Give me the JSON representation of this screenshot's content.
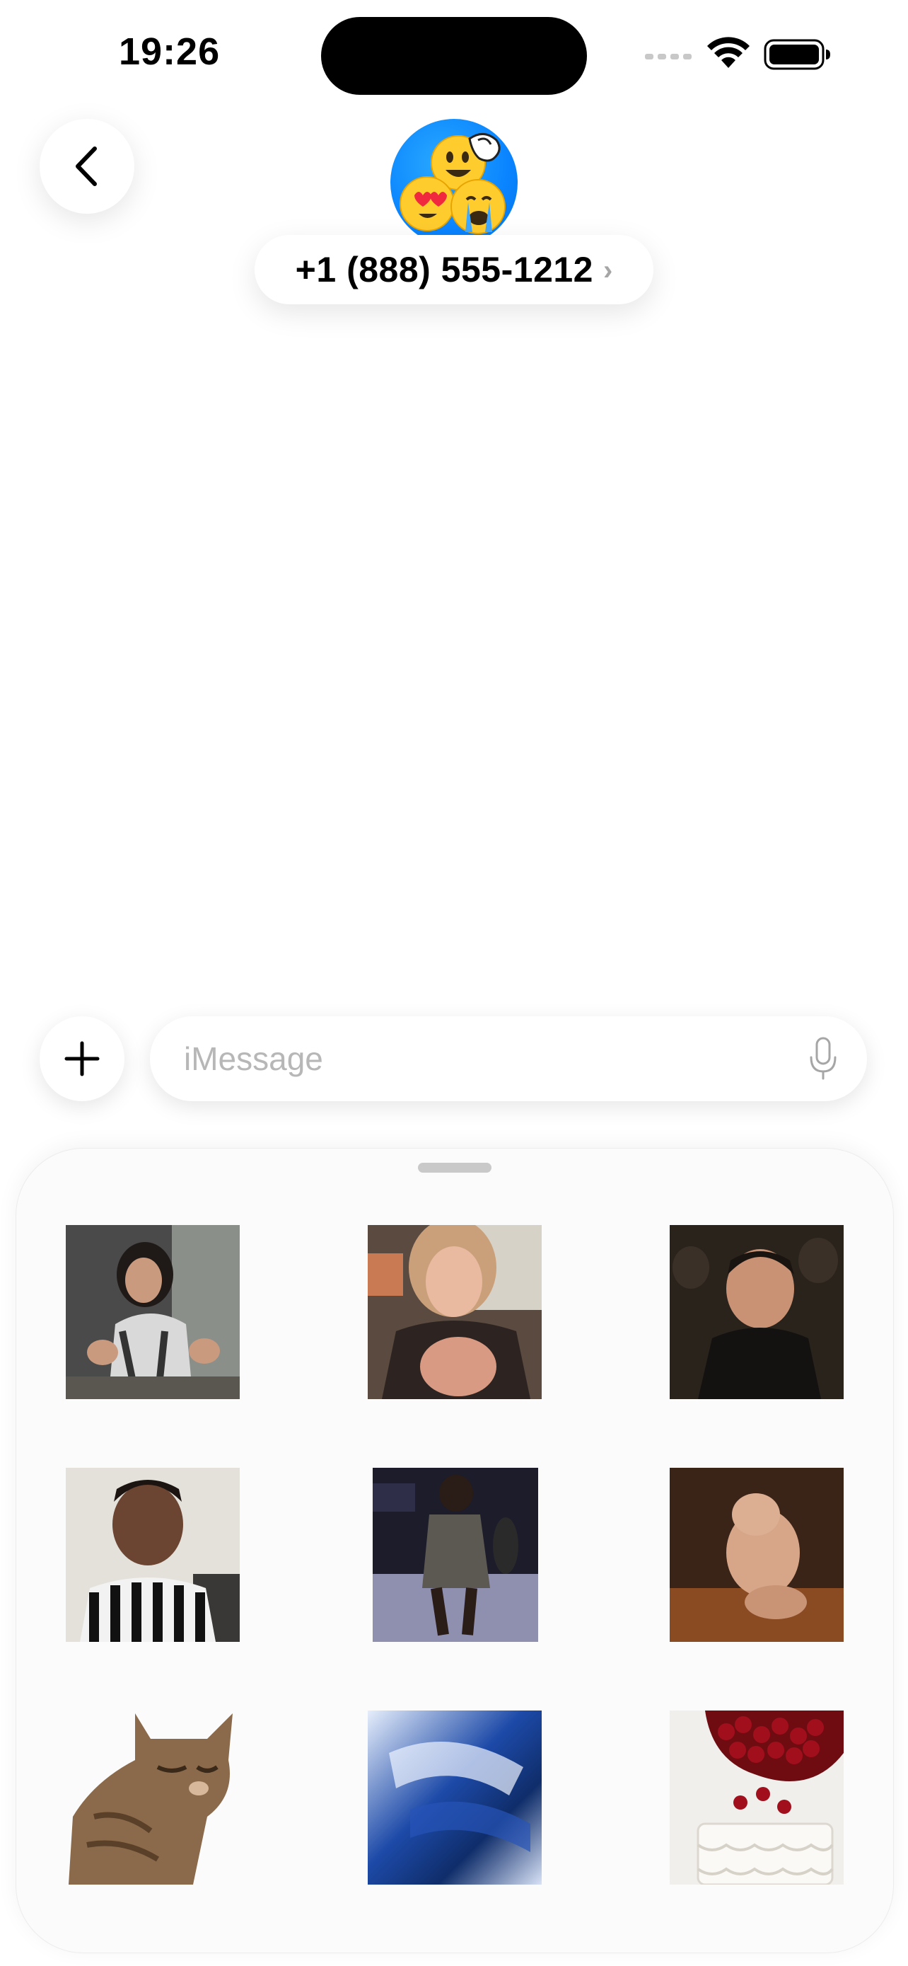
{
  "status_bar": {
    "time": "19:26",
    "icons": [
      "signal-icon",
      "wifi-icon",
      "battery-icon"
    ]
  },
  "header": {
    "back_icon": "chevron-left-icon",
    "avatar": "emoji-group-avatar",
    "contact_name": "+1 (888) 555-1212",
    "chevron": "›"
  },
  "compose": {
    "add_icon": "plus-icon",
    "placeholder": "iMessage",
    "value": "",
    "mic_icon": "microphone-icon"
  },
  "gif_panel": {
    "gifs": [
      {
        "id": "gif-woman-dancing",
        "subject": "woman dancing"
      },
      {
        "id": "gif-woman-pointing",
        "subject": "woman pointing"
      },
      {
        "id": "gif-man-smiling-audience",
        "subject": "man smiling in audience"
      },
      {
        "id": "gif-man-referee-shirt",
        "subject": "man in striped shirt"
      },
      {
        "id": "gif-woman-walking-stage",
        "subject": "woman walking on stage"
      },
      {
        "id": "gif-teddy-bear",
        "subject": "teddy bear"
      },
      {
        "id": "gif-cat",
        "subject": "cat"
      },
      {
        "id": "gif-blue-blur",
        "subject": "blue motion blur"
      },
      {
        "id": "gif-cherries-cake",
        "subject": "cherries falling onto cake"
      }
    ]
  },
  "colors": {
    "accent": "#0A84FF",
    "placeholder": "#B7B7B7",
    "panel_background": "#FBFBFB"
  }
}
